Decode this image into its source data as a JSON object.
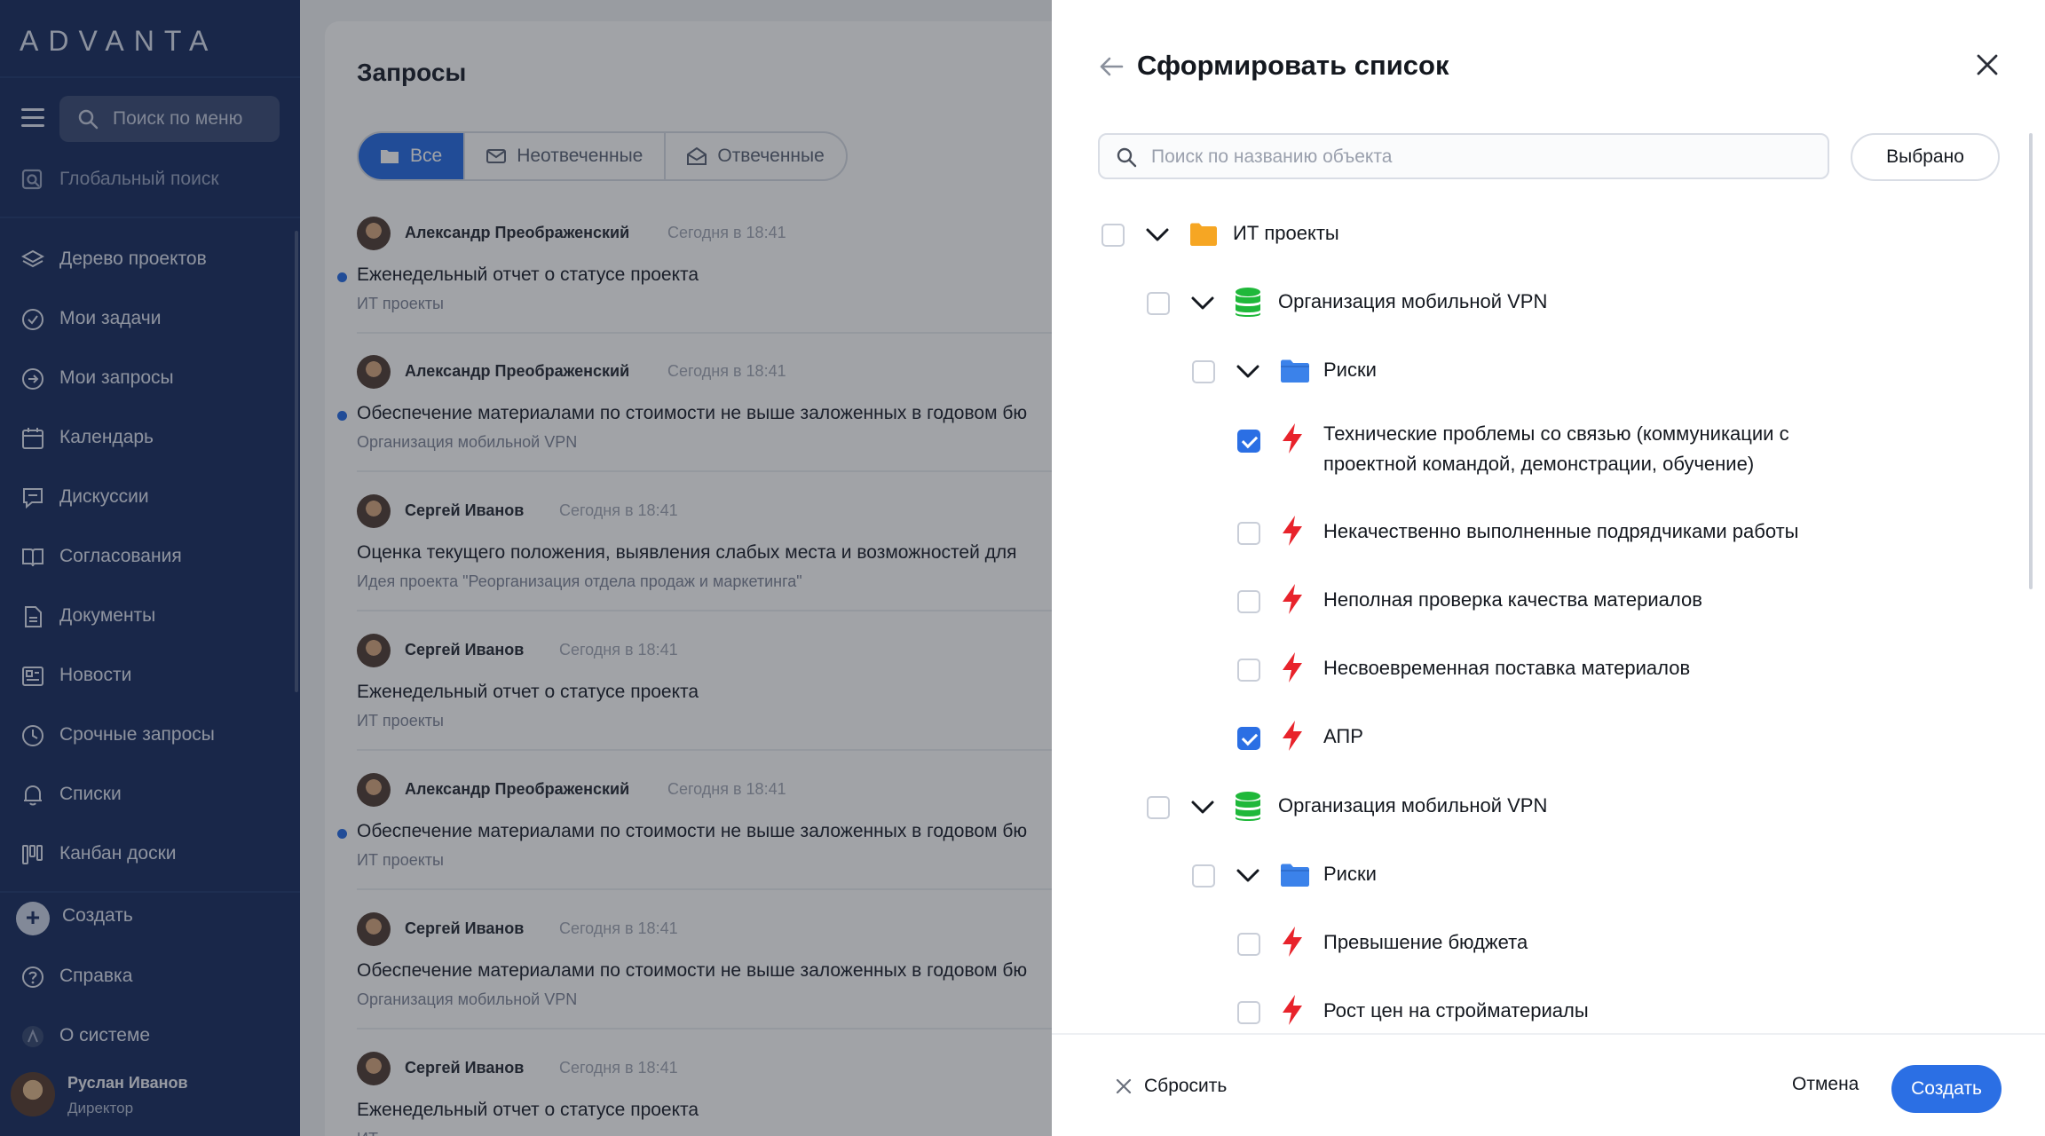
{
  "sidebar": {
    "logo": "ADVANTA",
    "search_placeholder": "Поиск по меню",
    "global_search": "Глобальный поиск",
    "items": [
      {
        "label": "Дерево проектов",
        "icon": "layers-icon"
      },
      {
        "label": "Мои задачи",
        "icon": "check-circle-icon"
      },
      {
        "label": "Мои запросы",
        "icon": "arrow-circle-icon"
      },
      {
        "label": "Календарь",
        "icon": "calendar-icon"
      },
      {
        "label": "Дискуссии",
        "icon": "chat-icon"
      },
      {
        "label": "Согласования",
        "icon": "book-icon"
      },
      {
        "label": "Документы",
        "icon": "document-icon"
      },
      {
        "label": "Новости",
        "icon": "news-icon"
      },
      {
        "label": "Срочные запросы",
        "icon": "clock-icon"
      },
      {
        "label": "Списки",
        "icon": "bell-icon"
      },
      {
        "label": "Канбан доски",
        "icon": "kanban-icon"
      }
    ],
    "create_label": "Создать",
    "help_label": "Справка",
    "about_label": "О системе",
    "user": {
      "name": "Руслан Иванов",
      "role": "Директор"
    }
  },
  "main": {
    "title": "Запросы",
    "tabs": [
      {
        "label": "Все",
        "active": true
      },
      {
        "label": "Неотвеченные",
        "active": false
      },
      {
        "label": "Отвеченные",
        "active": false
      }
    ],
    "requests": [
      {
        "author": "Александр Преображенский",
        "time": "Сегодня в 18:41",
        "title": "Еженедельный отчет о статусе проекта",
        "subtitle": "ИТ проекты",
        "unread": true
      },
      {
        "author": "Александр Преображенский",
        "time": "Сегодня в 18:41",
        "title": "Обеспечение материалами по стоимости не выше заложенных в годовом бю",
        "subtitle": "Организация мобильной VPN",
        "unread": true
      },
      {
        "author": "Сергей Иванов",
        "time": "Сегодня в 18:41",
        "title": "Оценка текущего положения, выявления слабых места и возможностей для",
        "subtitle": "Идея проекта \"Реорганизация отдела продаж и маркетинга\"",
        "unread": false
      },
      {
        "author": "Сергей Иванов",
        "time": "Сегодня в 18:41",
        "title": "Еженедельный отчет о статусе проекта",
        "subtitle": "ИТ проекты",
        "unread": false
      },
      {
        "author": "Александр Преображенский",
        "time": "Сегодня в 18:41",
        "title": "Обеспечение материалами по стоимости не выше заложенных в годовом бю",
        "subtitle": "ИТ проекты",
        "unread": true
      },
      {
        "author": "Сергей Иванов",
        "time": "Сегодня в 18:41",
        "title": "Обеспечение материалами по стоимости не выше заложенных в годовом бю",
        "subtitle": "Организация мобильной VPN",
        "unread": false
      },
      {
        "author": "Сергей Иванов",
        "time": "Сегодня в 18:41",
        "title": "Еженедельный отчет о статусе проекта",
        "subtitle": "ИТ",
        "unread": false
      }
    ]
  },
  "panel": {
    "title": "Сформировать список",
    "search_placeholder": "Поиск по названию объекта",
    "selected_button": "Выбрано",
    "tree": [
      {
        "label": "ИТ проекты",
        "type": "folder-orange",
        "checked": false
      },
      {
        "label": "Организация мобильной VPN",
        "type": "project",
        "checked": false
      },
      {
        "label": "Риски",
        "type": "folder-blue",
        "checked": false
      },
      {
        "label": "Технические проблемы со связью (коммуникации с",
        "label2": "проектной командой, демонстрации, обучение)",
        "type": "risk",
        "checked": true
      },
      {
        "label": "Некачественно выполненные подрядчиками работы",
        "type": "risk",
        "checked": false
      },
      {
        "label": "Неполная проверка качества материалов",
        "type": "risk",
        "checked": false
      },
      {
        "label": "Несвоевременная поставка материалов",
        "type": "risk",
        "checked": false
      },
      {
        "label": "АПР",
        "type": "risk",
        "checked": true
      },
      {
        "label": "Организация мобильной VPN",
        "type": "project",
        "checked": false
      },
      {
        "label": "Риски",
        "type": "folder-blue",
        "checked": false
      },
      {
        "label": "Превышение бюджета",
        "type": "risk",
        "checked": false
      },
      {
        "label": "Рост цен на стройматериалы",
        "type": "risk",
        "checked": false
      }
    ],
    "footer": {
      "reset_label": "Сбросить",
      "cancel_label": "Отмена",
      "create_label": "Создать"
    }
  },
  "colors": {
    "sidebar_bg": "#1d3163",
    "accent": "#2b6fe4",
    "risk_red": "#e8232b",
    "project_green": "#1fb83a",
    "folder_orange": "#f6a623",
    "folder_blue": "#3b82ea"
  }
}
